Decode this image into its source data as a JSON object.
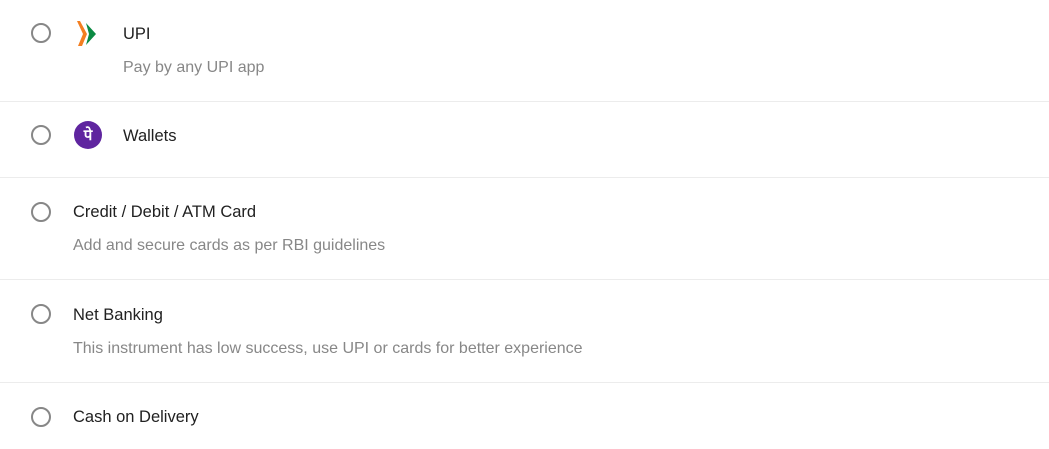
{
  "payment_options": [
    {
      "id": "upi",
      "title": "UPI",
      "subtitle": "Pay by any UPI app",
      "icon": "upi-logo-icon",
      "selected": false
    },
    {
      "id": "wallets",
      "title": "Wallets",
      "subtitle": "",
      "icon": "phonepe-logo-icon",
      "selected": false
    },
    {
      "id": "card",
      "title": "Credit / Debit / ATM Card",
      "subtitle": "Add and secure cards as per RBI guidelines",
      "selected": false
    },
    {
      "id": "netbanking",
      "title": "Net Banking",
      "subtitle": "This instrument has low success, use UPI or cards for better experience",
      "selected": false
    },
    {
      "id": "cod",
      "title": "Cash on Delivery",
      "subtitle": "",
      "selected": false
    }
  ],
  "colors": {
    "title_text": "#212121",
    "subtitle_text": "#878787",
    "radio_border": "#878787",
    "divider": "#ececec",
    "phonepe_purple": "#5f259f",
    "upi_orange": "#f37e20",
    "upi_green": "#0b8a43"
  },
  "icons": {
    "phonepe_glyph": "पे"
  }
}
